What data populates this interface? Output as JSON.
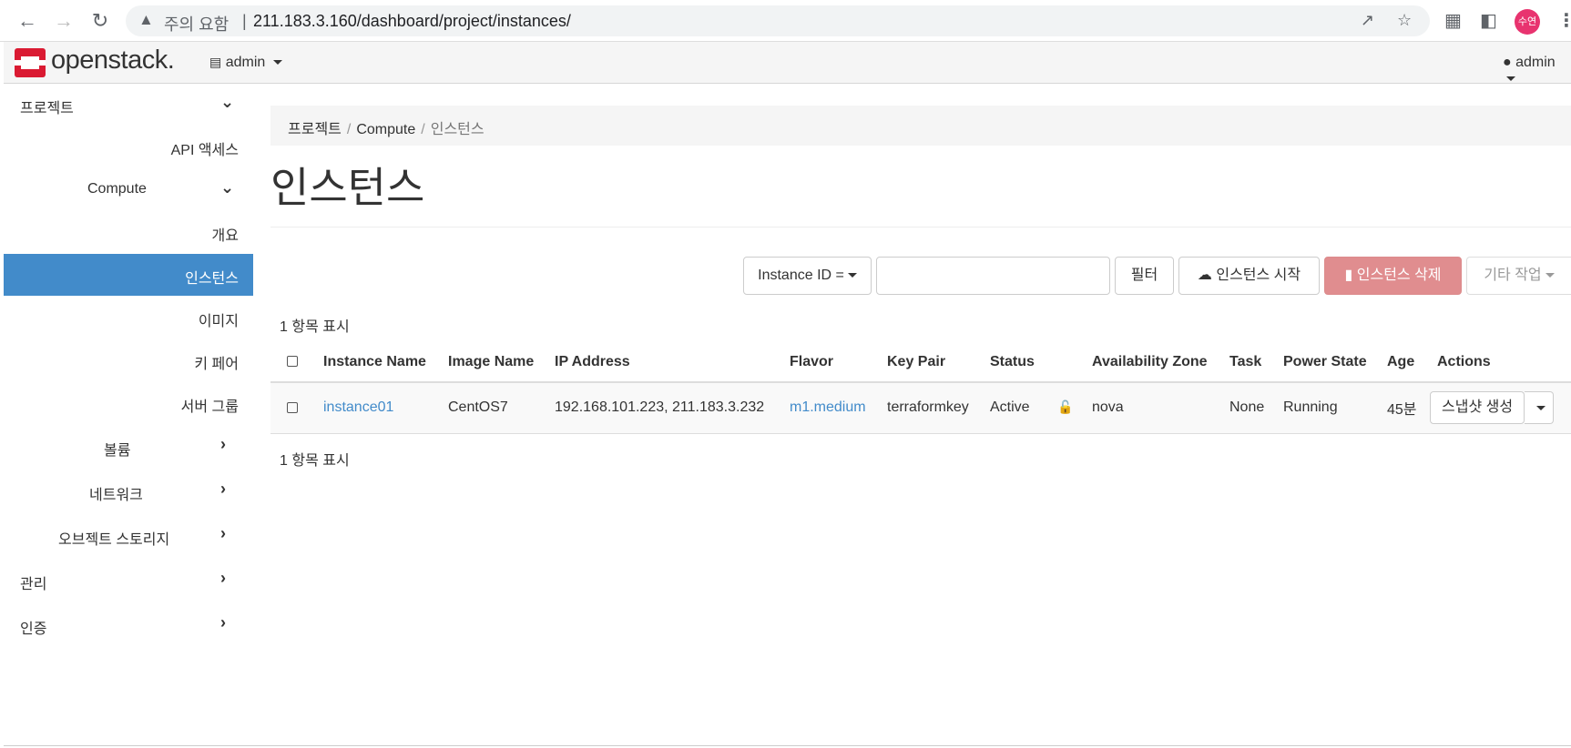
{
  "browser": {
    "warning_label": "주의 요함",
    "separator": "|",
    "url": "211.183.3.160/dashboard/project/instances/",
    "profile_initials": "수연",
    "icons": [
      "back-icon",
      "forward-icon",
      "reload-icon",
      "warning-icon",
      "share-icon",
      "star-icon",
      "extensions-icon",
      "sidepanel-icon",
      "menu-icon"
    ]
  },
  "header": {
    "logo_text": "openstack.",
    "project_switch": "admin",
    "user_menu": "admin",
    "brand_color": "#da1a32"
  },
  "sidebar": {
    "items": [
      {
        "label": "프로젝트",
        "chevron": "down"
      },
      {
        "label": "API 액세스"
      },
      {
        "label": "Compute",
        "chevron": "down"
      },
      {
        "label": "개요"
      },
      {
        "label": "인스턴스",
        "active": true
      },
      {
        "label": "이미지"
      },
      {
        "label": "키 페어"
      },
      {
        "label": "서버 그룹"
      },
      {
        "label": "볼륨",
        "chevron": "right"
      },
      {
        "label": "네트워크",
        "chevron": "right"
      },
      {
        "label": "오브젝트 스토리지",
        "chevron": "right"
      },
      {
        "label": "관리",
        "chevron": "right"
      },
      {
        "label": "인증",
        "chevron": "right"
      }
    ],
    "active_color": "#428bca"
  },
  "breadcrumb": {
    "items": [
      "프로젝트",
      "Compute",
      "인스턴스"
    ],
    "sep": "/"
  },
  "page": {
    "title": "인스턴스"
  },
  "toolbar": {
    "filter_select": "Instance ID =",
    "filter_input_value": "",
    "filter_button": "필터",
    "launch_button": "인스턴스 시작",
    "delete_button": "인스턴스 삭제",
    "more_button": "기타 작업"
  },
  "table": {
    "count_top": "1 항목 표시",
    "count_bottom": "1 항목 표시",
    "columns": [
      "Instance Name",
      "Image Name",
      "IP Address",
      "Flavor",
      "Key Pair",
      "Status",
      "Availability Zone",
      "Task",
      "Power State",
      "Age",
      "Actions"
    ],
    "rows": [
      {
        "instance_name": "instance01",
        "image_name": "CentOS7",
        "ip_address": "192.168.101.223, 211.183.3.232",
        "flavor": "m1.medium",
        "key_pair": "terraformkey",
        "status": "Active",
        "availability_zone": "nova",
        "task": "None",
        "power_state": "Running",
        "age": "45분",
        "action": "스냅샷 생성"
      }
    ]
  }
}
